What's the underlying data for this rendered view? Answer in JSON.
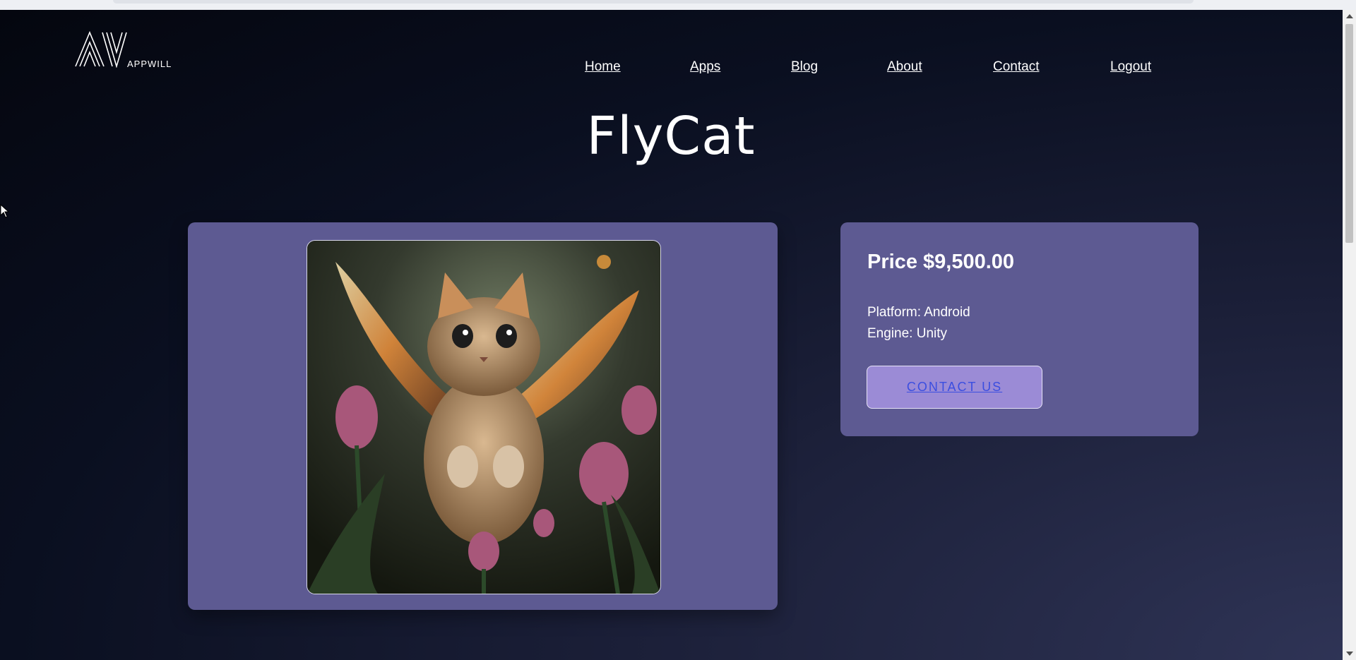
{
  "brand": {
    "name": "APPWILL",
    "logo_icon": "appwill-logo-icon"
  },
  "nav": {
    "items": [
      {
        "label": "Home"
      },
      {
        "label": "Apps"
      },
      {
        "label": "Blog"
      },
      {
        "label": "About"
      },
      {
        "label": "Contact"
      },
      {
        "label": "Logout"
      }
    ]
  },
  "page": {
    "title": "FlyCat"
  },
  "product": {
    "image_icon": "flying-cat-image",
    "price": "Price $9,500.00",
    "platform": "Platform: Android",
    "engine": "Engine: Unity",
    "cta_label": "CONTACT US"
  },
  "colors": {
    "card": "#5d5a92",
    "button": "#9b8bd6",
    "button_text": "#3b4ee0"
  }
}
